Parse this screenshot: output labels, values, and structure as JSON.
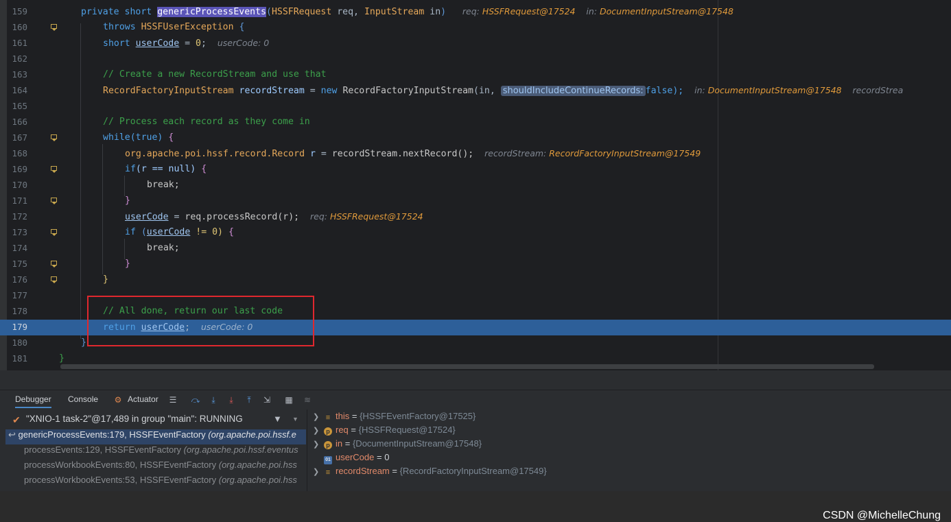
{
  "editor": {
    "lines": [
      {
        "n": "159"
      },
      {
        "n": "160"
      },
      {
        "n": "161"
      },
      {
        "n": "162"
      },
      {
        "n": "163"
      },
      {
        "n": "164"
      },
      {
        "n": "165"
      },
      {
        "n": "166"
      },
      {
        "n": "167"
      },
      {
        "n": "168"
      },
      {
        "n": "169"
      },
      {
        "n": "170"
      },
      {
        "n": "171"
      },
      {
        "n": "172"
      },
      {
        "n": "173"
      },
      {
        "n": "174"
      },
      {
        "n": "175"
      },
      {
        "n": "176"
      },
      {
        "n": "177"
      },
      {
        "n": "178"
      },
      {
        "n": "179"
      },
      {
        "n": "180"
      },
      {
        "n": "181"
      }
    ],
    "code": {
      "l159": {
        "private": "private",
        "short": "short",
        "method": "genericProcessEvents",
        "p1type": "HSSFRequest",
        "p1": "req,",
        "p2type": "InputStream",
        "p2": "in",
        "hint1": "req:",
        "hint1v": "HSSFRequest@17524",
        "hint2": "in:",
        "hint2v": "DocumentInputStream@17548"
      },
      "l160": {
        "throws": "throws",
        "exc": "HSSFUserException",
        "brace": "{"
      },
      "l161": {
        "short": "short",
        "var": "userCode",
        "eq": "=",
        "val": "0",
        "semi": ";",
        "hint": "userCode: 0"
      },
      "l163": {
        "comment": "// Create a new RecordStream and use that"
      },
      "l164": {
        "type": "RecordFactoryInputStream",
        "var": "recordStream",
        "eq": "=",
        "new": "new",
        "ctor": "RecordFactoryInputStream",
        "arg1": "(in,",
        "param": "shouldIncludeContinueRecords:",
        "arg2": "false);",
        "hint1": "in:",
        "hint1v": "DocumentInputStream@17548",
        "hint2": "recordStrea"
      },
      "l166": {
        "comment": "// Process each record as they come in"
      },
      "l167": {
        "while": "while",
        "cond": "(true)",
        "brace": "{"
      },
      "l168": {
        "type": "org.apache.poi.hssf.record.Record",
        "var": "r",
        "eq": "=",
        "call": "recordStream.nextRecord();",
        "hint": "recordStream:",
        "hintv": "RecordFactoryInputStream@17549"
      },
      "l169": {
        "if": "if",
        "cond": "(r == null)",
        "brace": "{"
      },
      "l170": {
        "break": "break;"
      },
      "l171": {
        "brace": "}"
      },
      "l172": {
        "var": "userCode",
        "eq": "=",
        "call": "req.processRecord(r);",
        "hint": "req:",
        "hintv": "HSSFRequest@17524"
      },
      "l173": {
        "if": "if",
        "cond1": "(",
        "var": "userCode",
        "cond2": "!= 0)",
        "brace": "{"
      },
      "l174": {
        "break": "break;"
      },
      "l175": {
        "brace": "}"
      },
      "l176": {
        "brace": "}"
      },
      "l178": {
        "comment": "// All done, return our last code"
      },
      "l179": {
        "return": "return",
        "var": "userCode",
        "semi": ";",
        "hint": "userCode: 0"
      },
      "l180": {
        "brace": "}"
      },
      "l181": {
        "brace": "}"
      }
    }
  },
  "debugger": {
    "tabs": {
      "debugger": "Debugger",
      "console": "Console",
      "actuator": "Actuator"
    },
    "thread": "\"XNIO-1 task-2\"@17,489 in group \"main\": RUNNING",
    "frames": [
      {
        "method": "genericProcessEvents:179, HSSFEventFactory",
        "pkg": "(org.apache.poi.hssf.e"
      },
      {
        "method": "processEvents:129, HSSFEventFactory",
        "pkg": "(org.apache.poi.hssf.eventus"
      },
      {
        "method": "processWorkbookEvents:80, HSSFEventFactory",
        "pkg": "(org.apache.poi.hss"
      },
      {
        "method": "processWorkbookEvents:53, HSSFEventFactory",
        "pkg": "(org.apache.poi.hss"
      }
    ],
    "variables": [
      {
        "name": "this",
        "eq": "=",
        "value": "{HSSFEventFactory@17525}"
      },
      {
        "name": "req",
        "eq": "=",
        "value": "{HSSFRequest@17524}"
      },
      {
        "name": "in",
        "eq": "=",
        "value": "{DocumentInputStream@17548}"
      },
      {
        "name": "userCode",
        "eq": "=",
        "value": "0"
      },
      {
        "name": "recordStream",
        "eq": "=",
        "value": "{RecordFactoryInputStream@17549}"
      }
    ]
  },
  "watermark": "CSDN @MichelleChung"
}
